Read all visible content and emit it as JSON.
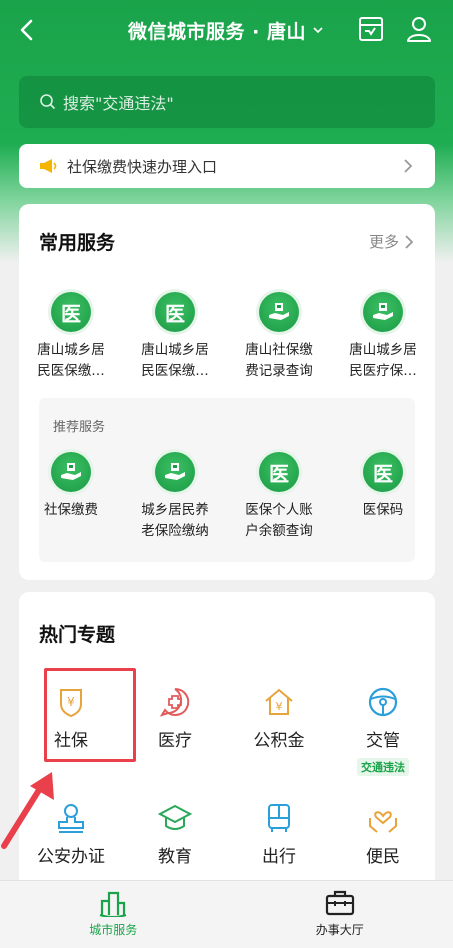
{
  "header": {
    "title": "微信城市服务 · 唐山",
    "back_icon": "chevron-left-icon",
    "icons": [
      "inbox-icon",
      "user-icon"
    ]
  },
  "search": {
    "placeholder": "搜索\"交通违法\""
  },
  "notice": {
    "text": "社保缴费快速办理入口"
  },
  "common": {
    "title": "常用服务",
    "more": "更多",
    "items": [
      {
        "l1": "唐山城乡居",
        "l2": "民医保缴…",
        "icon": "yi"
      },
      {
        "l1": "唐山城乡居",
        "l2": "民医保缴…",
        "icon": "yi"
      },
      {
        "l1": "唐山社保缴",
        "l2": "费记录查询",
        "icon": "hand"
      },
      {
        "l1": "唐山城乡居",
        "l2": "民医疗保…",
        "icon": "hand"
      }
    ],
    "recommend_title": "推荐服务",
    "recommend": [
      {
        "l1": "社保缴费",
        "l2": "",
        "icon": "hand"
      },
      {
        "l1": "城乡居民养",
        "l2": "老保险缴纳",
        "icon": "hand"
      },
      {
        "l1": "医保个人账",
        "l2": "户余额查询",
        "icon": "yi"
      },
      {
        "l1": "医保码",
        "l2": "",
        "icon": "yi"
      }
    ],
    "yi_char": "医"
  },
  "hot": {
    "title": "热门专题",
    "row1": [
      {
        "label": "社保",
        "icon": "yuan-shield-icon",
        "color": "#e8a33a"
      },
      {
        "label": "医疗",
        "icon": "medical-cross-icon",
        "color": "#e25b5b"
      },
      {
        "label": "公积金",
        "icon": "house-yuan-icon",
        "color": "#e8a33a"
      },
      {
        "label": "交管",
        "icon": "steering-wheel-icon",
        "color": "#2b9fd9",
        "tag": "交通违法"
      }
    ],
    "row2": [
      {
        "label": "公安办证",
        "icon": "stamp-icon",
        "color": "#2b9fd9"
      },
      {
        "label": "教育",
        "icon": "graduation-cap-icon",
        "color": "#2aa85a"
      },
      {
        "label": "出行",
        "icon": "bus-icon",
        "color": "#2b9fd9"
      },
      {
        "label": "便民",
        "icon": "heart-hands-icon",
        "color": "#e8a33a"
      }
    ]
  },
  "tabbar": [
    {
      "label": "城市服务",
      "active": true,
      "icon": "city-buildings-icon"
    },
    {
      "label": "办事大厅",
      "active": false,
      "icon": "briefcase-icon"
    }
  ],
  "colors": {
    "brand": "#1aa34a",
    "highlight": "#e9404b"
  }
}
